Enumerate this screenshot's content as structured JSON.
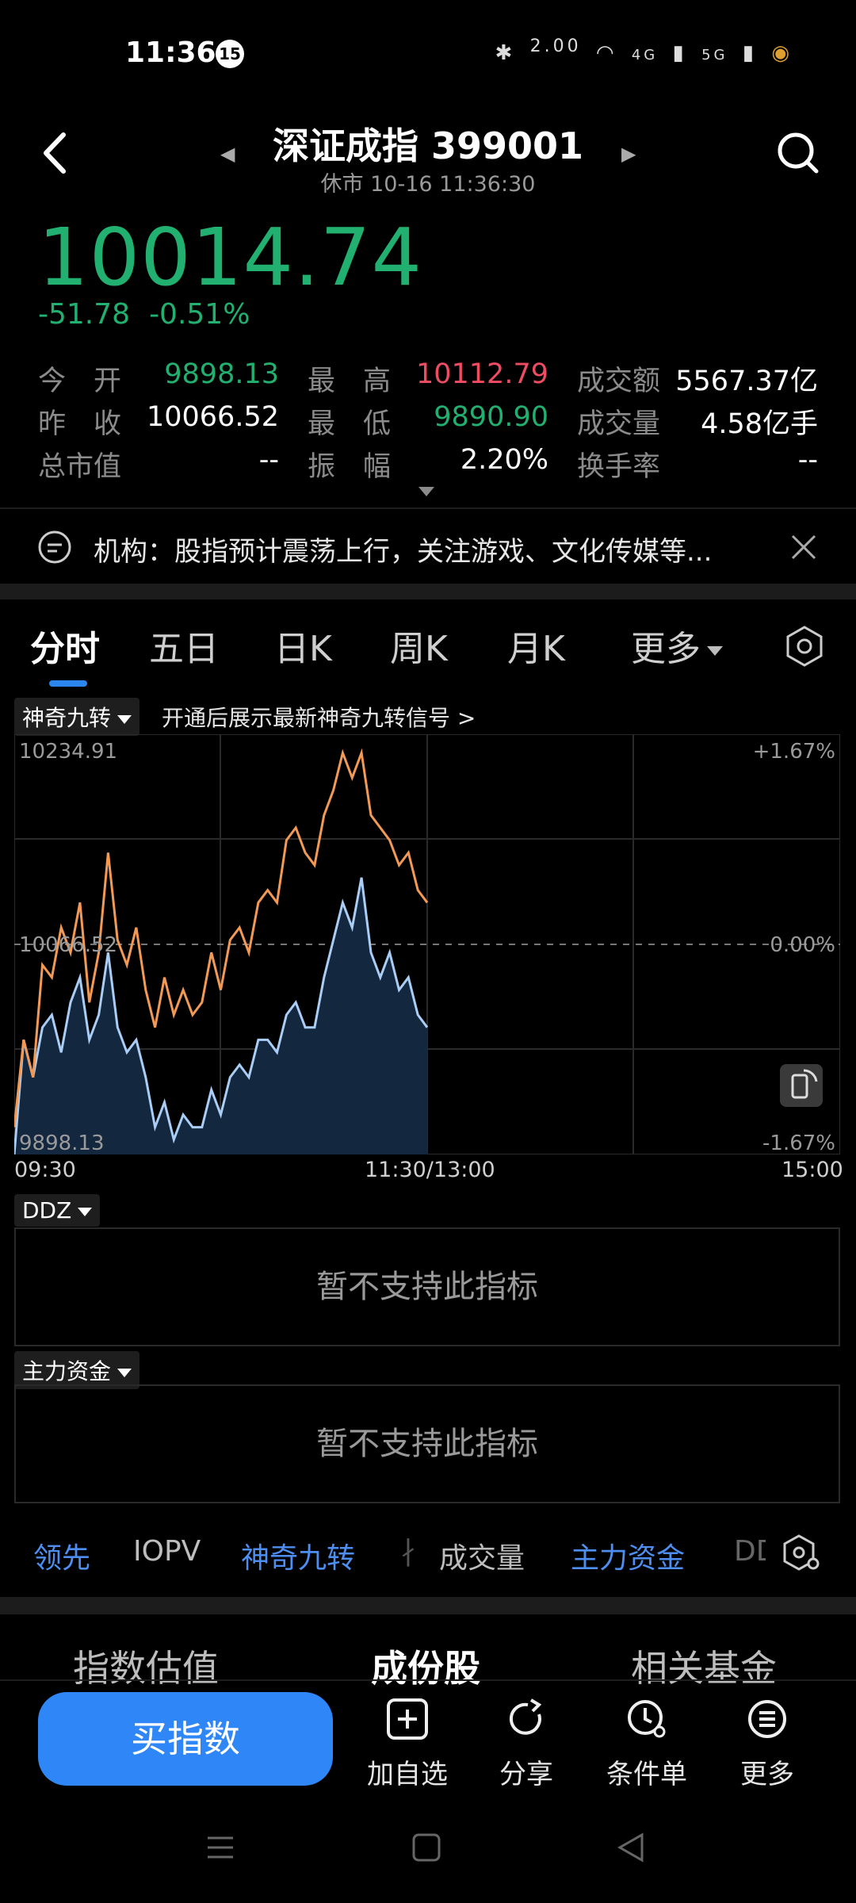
{
  "status": {
    "time": "11:36",
    "badge": "15",
    "speed": "2.00",
    "net1": "4G",
    "net2": "5G"
  },
  "header": {
    "title": "深证成指 399001",
    "subtitle": "休市 10-16 11:36:30"
  },
  "quote": {
    "price": "10014.74",
    "change": "-51.78",
    "change_pct": "-0.51%"
  },
  "stats": {
    "open_label": "今　开",
    "open": "9898.13",
    "high_label": "最　高",
    "high": "10112.79",
    "amount_label": "成交额",
    "amount": "5567.37亿",
    "prev_close_label": "昨　收",
    "prev_close": "10066.52",
    "low_label": "最　低",
    "low": "9890.90",
    "volume_label": "成交量",
    "volume": "4.58亿手",
    "mktcap_label": "总市值",
    "mktcap": "--",
    "amplitude_label": "振　幅",
    "amplitude": "2.20%",
    "turnover_label": "换手率",
    "turnover": "--"
  },
  "news": {
    "text": "机构：股指预计震荡上行，关注游戏、文化传媒等..."
  },
  "chart_tabs": [
    "分时",
    "五日",
    "日K",
    "周K",
    "月K",
    "更多"
  ],
  "indicator": {
    "chip": "神奇九转",
    "hint": "开通后展示最新神奇九转信号 >"
  },
  "chart_data": {
    "type": "line",
    "y_labels": {
      "top": "10234.91",
      "mid": "10066.52",
      "bottom": "9898.13"
    },
    "pct_labels": {
      "top": "+1.67%",
      "mid": "0.00%",
      "bottom": "-1.67%"
    },
    "x_labels": [
      "09:30",
      "11:30/13:00",
      "15:00"
    ],
    "ylim": [
      9898.13,
      10234.91
    ],
    "colors": {
      "price": "#f29a55",
      "average": "#a9cdf5"
    },
    "series": [
      {
        "values": [
          9920,
          9990,
          9960,
          10050,
          10040,
          10080,
          10060,
          10100,
          10020,
          10060,
          10140,
          10070,
          10050,
          10080,
          10030,
          10000,
          10040,
          10010,
          10030,
          10010,
          10020,
          10060,
          10030,
          10070,
          10080,
          10060,
          10100,
          10110,
          10100,
          10150,
          10160,
          10140,
          10130,
          10170,
          10190,
          10220,
          10200,
          10220,
          10170,
          10160,
          10150,
          10130,
          10140,
          10110,
          10100
        ]
      },
      {
        "values": [
          9898,
          9990,
          9960,
          10000,
          10010,
          9980,
          10020,
          10040,
          9990,
          10010,
          10060,
          10000,
          9980,
          9990,
          9960,
          9920,
          9940,
          9910,
          9930,
          9920,
          9920,
          9950,
          9930,
          9960,
          9970,
          9960,
          9990,
          9990,
          9980,
          10010,
          10020,
          10000,
          10000,
          10040,
          10070,
          10100,
          10080,
          10120,
          10060,
          10040,
          10060,
          10030,
          10040,
          10010,
          10000
        ]
      }
    ]
  },
  "ddz": {
    "chip": "DDZ",
    "msg": "暂不支持此指标"
  },
  "fund": {
    "chip": "主力资金",
    "msg": "暂不支持此指标"
  },
  "indicator_tabs": [
    "领先",
    "IOPV",
    "神奇九转",
    "成交量",
    "主力资金",
    "DD"
  ],
  "bottom_tabs": [
    "指数估值",
    "成份股",
    "相关基金"
  ],
  "actions": {
    "buy": "买指数",
    "watch": "加自选",
    "share": "分享",
    "order": "条件单",
    "more": "更多"
  }
}
